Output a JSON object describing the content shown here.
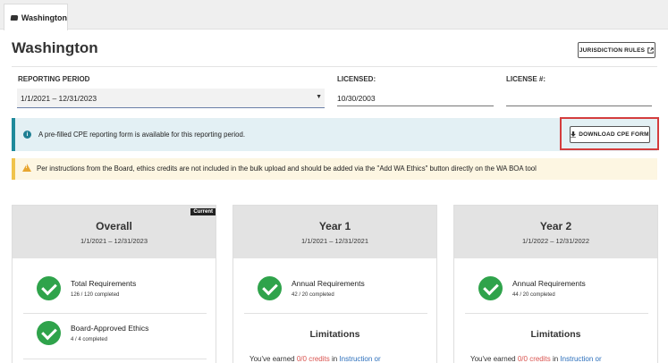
{
  "tab": {
    "label": "Washington",
    "icon": "state-map-icon"
  },
  "page": {
    "title": "Washington"
  },
  "header": {
    "jurisdiction_rules_label": "JURISDICTION RULES",
    "external_icon": "external-link-icon"
  },
  "form": {
    "reporting_period_label": "REPORTING PERIOD",
    "reporting_period_value": "1/1/2021 – 12/31/2023",
    "licensed_label": "LICENSED:",
    "licensed_value": "10/30/2003",
    "license_number_label": "LICENSE #:",
    "license_number_value": ""
  },
  "info_banner": {
    "icon": "info-icon",
    "text": "A pre-filled CPE reporting form is available for this reporting period.",
    "download_label": "DOWNLOAD CPE FORM",
    "download_icon": "download-icon"
  },
  "warning_banner": {
    "icon": "warning-icon",
    "text": "Per instructions from the Board, ethics credits are not included in the bulk upload and should be added via the \"Add WA Ethics\" button directly on the WA BOA tool"
  },
  "cards": [
    {
      "title": "Overall",
      "dates": "1/1/2021 – 12/31/2023",
      "badge": "Current",
      "requirements": [
        {
          "title": "Total Requirements",
          "sub": "126 / 120 completed"
        },
        {
          "title": "Board-Approved Ethics",
          "sub": "4 / 4 completed"
        }
      ]
    },
    {
      "title": "Year 1",
      "dates": "1/1/2021 – 12/31/2021",
      "requirements": [
        {
          "title": "Annual Requirements",
          "sub": "42 / 20 completed"
        }
      ],
      "limitations_title": "Limitations",
      "limit_prefix": "You've earned ",
      "limit_value": "0/0 credits",
      "limit_mid": " in ",
      "limit_link": "Instruction or"
    },
    {
      "title": "Year 2",
      "dates": "1/1/2022 – 12/31/2022",
      "requirements": [
        {
          "title": "Annual Requirements",
          "sub": "44 / 20 completed"
        }
      ],
      "limitations_title": "Limitations",
      "limit_prefix": "You've earned ",
      "limit_value": "0/0 credits",
      "limit_mid": " in ",
      "limit_link": "Instruction or"
    }
  ],
  "colors": {
    "accent_teal": "#1f8a9b",
    "success_green": "#2fa34b",
    "warning_amber": "#f0c34b",
    "highlight_red": "#d43d3d",
    "link_blue": "#2a6ebb"
  }
}
